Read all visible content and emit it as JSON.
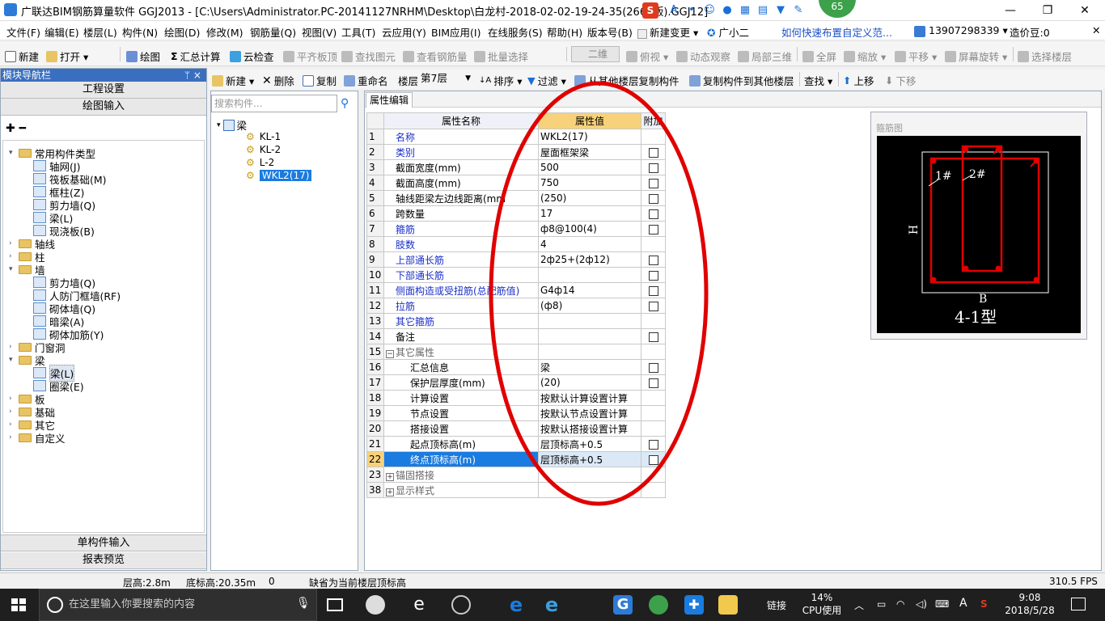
{
  "window": {
    "title": "广联达BIM钢筋算量软件 GGJ2013 - [C:\\Users\\Administrator.PC-20141127NRHM\\Desktop\\白龙村-2018-02-02-19-24-35(2666版).GGJ12]",
    "badge": "65",
    "controls": {
      "minimize": "—",
      "maximize": "❐",
      "close": "✕"
    }
  },
  "menubar": {
    "items": [
      "文件(F)",
      "编辑(E)",
      "楼层(L)",
      "构件(N)",
      "绘图(D)",
      "修改(M)",
      "钢筋量(Q)",
      "视图(V)",
      "工具(T)",
      "云应用(Y)",
      "BIM应用(I)",
      "在线服务(S)",
      "帮助(H)",
      "版本号(B)",
      "新建变更 ▾",
      "广小二"
    ],
    "help_link": "如何快速布置自定义范...",
    "phone": "13907298339 ▾",
    "coins": "造价豆:0"
  },
  "toolbar1": {
    "new": "新建",
    "open": "打开 ▾",
    "draw": "绘图",
    "sum": "汇总计算",
    "cloud_check": "云检查",
    "flat_roof": "平齐板顶",
    "find_elem": "查找图元",
    "view_qty": "查看钢筋量",
    "batch_select": "批量选择",
    "view_mode": "二维",
    "top_view": "俯视 ▾",
    "dynamic": "动态观察",
    "local3d": "局部三维",
    "fullscreen": "全屏",
    "zoom": "缩放 ▾",
    "pan": "平移 ▾",
    "rotate": "屏幕旋转 ▾",
    "floor_select": "选择楼层"
  },
  "toolbar2": {
    "new": "新建 ▾",
    "delete": "删除",
    "copy": "复制",
    "rename": "重命名",
    "floor_label": "楼层",
    "floor_value": "第7层",
    "sort": "排序 ▾",
    "filter": "过滤 ▾",
    "copy_from": "从其他楼层复制构件",
    "copy_to": "复制构件到其他楼层",
    "find": "查找 ▾",
    "move_up": "上移",
    "move_down": "下移"
  },
  "nav": {
    "header": "模块导航栏",
    "pin": "ᛘ ×",
    "project_settings": "工程设置",
    "draw_input": "绘图输入",
    "single_input": "单构件输入",
    "report": "报表预览",
    "tree": [
      {
        "label": "常用构件类型",
        "level": 0,
        "toggle": "▾",
        "type": "folder"
      },
      {
        "label": "轴网(J)",
        "level": 1,
        "type": "item"
      },
      {
        "label": "筏板基础(M)",
        "level": 1,
        "type": "item"
      },
      {
        "label": "框柱(Z)",
        "level": 1,
        "type": "item"
      },
      {
        "label": "剪力墙(Q)",
        "level": 1,
        "type": "item"
      },
      {
        "label": "梁(L)",
        "level": 1,
        "type": "item"
      },
      {
        "label": "现浇板(B)",
        "level": 1,
        "type": "item"
      },
      {
        "label": "轴线",
        "level": 0,
        "toggle": "›",
        "type": "folder"
      },
      {
        "label": "柱",
        "level": 0,
        "toggle": "›",
        "type": "folder"
      },
      {
        "label": "墙",
        "level": 0,
        "toggle": "▾",
        "type": "folder"
      },
      {
        "label": "剪力墙(Q)",
        "level": 1,
        "type": "item"
      },
      {
        "label": "人防门框墙(RF)",
        "level": 1,
        "type": "item"
      },
      {
        "label": "砌体墙(Q)",
        "level": 1,
        "type": "item"
      },
      {
        "label": "暗梁(A)",
        "level": 1,
        "type": "item"
      },
      {
        "label": "砌体加筋(Y)",
        "level": 1,
        "type": "item"
      },
      {
        "label": "门窗洞",
        "level": 0,
        "toggle": "›",
        "type": "folder"
      },
      {
        "label": "梁",
        "level": 0,
        "toggle": "▾",
        "type": "folder"
      },
      {
        "label": "梁(L)",
        "level": 1,
        "type": "item",
        "selected": true
      },
      {
        "label": "圈梁(E)",
        "level": 1,
        "type": "item"
      },
      {
        "label": "板",
        "level": 0,
        "toggle": "›",
        "type": "folder"
      },
      {
        "label": "基础",
        "level": 0,
        "toggle": "›",
        "type": "folder"
      },
      {
        "label": "其它",
        "level": 0,
        "toggle": "›",
        "type": "folder"
      },
      {
        "label": "自定义",
        "level": 0,
        "toggle": "›",
        "type": "folder"
      }
    ]
  },
  "components": {
    "search_placeholder": "搜索构件...",
    "root": "梁",
    "items": [
      "KL-1",
      "KL-2",
      "L-2",
      "WKL2(17)"
    ],
    "selected": "WKL2(17)"
  },
  "property_panel": {
    "tab": "属性编辑",
    "headers": {
      "name": "属性名称",
      "value": "属性值",
      "extra": "附加"
    },
    "rows": [
      {
        "no": "1",
        "name": "名称",
        "value": "WKL2(17)",
        "cb": false,
        "style": "blue"
      },
      {
        "no": "2",
        "name": "类别",
        "value": "屋面框架梁",
        "cb": true,
        "style": "blue"
      },
      {
        "no": "3",
        "name": "截面宽度(mm)",
        "value": "500",
        "cb": true,
        "style": ""
      },
      {
        "no": "4",
        "name": "截面高度(mm)",
        "value": "750",
        "cb": true,
        "style": ""
      },
      {
        "no": "5",
        "name": "轴线距梁左边线距离(mm",
        "value": "(250)",
        "cb": true,
        "style": ""
      },
      {
        "no": "6",
        "name": "跨数量",
        "value": "17",
        "cb": true,
        "style": ""
      },
      {
        "no": "7",
        "name": "箍筋",
        "value": "ф8@100(4)",
        "cb": true,
        "style": "blue"
      },
      {
        "no": "8",
        "name": "肢数",
        "value": "4",
        "cb": false,
        "style": "blue"
      },
      {
        "no": "9",
        "name": "上部通长筋",
        "value": "2ф25+(2ф12)",
        "cb": true,
        "style": "blue"
      },
      {
        "no": "10",
        "name": "下部通长筋",
        "value": "",
        "cb": true,
        "style": "blue"
      },
      {
        "no": "11",
        "name": "侧面构造或受扭筋(总配筋值)",
        "value": "G4ф14",
        "cb": true,
        "style": "blue"
      },
      {
        "no": "12",
        "name": "拉筋",
        "value": "(ф8)",
        "cb": true,
        "style": "blue"
      },
      {
        "no": "13",
        "name": "其它箍筋",
        "value": "",
        "cb": false,
        "style": "blue"
      },
      {
        "no": "14",
        "name": "备注",
        "value": "",
        "cb": true,
        "style": ""
      },
      {
        "no": "15",
        "name": "其它属性",
        "value": "",
        "cb": false,
        "style": "gray",
        "group": "−"
      },
      {
        "no": "16",
        "name": "汇总信息",
        "value": "梁",
        "cb": true,
        "style": "",
        "indent": true
      },
      {
        "no": "17",
        "name": "保护层厚度(mm)",
        "value": "(20)",
        "cb": true,
        "style": "",
        "indent": true
      },
      {
        "no": "18",
        "name": "计算设置",
        "value": "按默认计算设置计算",
        "cb": false,
        "style": "",
        "indent": true
      },
      {
        "no": "19",
        "name": "节点设置",
        "value": "按默认节点设置计算",
        "cb": false,
        "style": "",
        "indent": true
      },
      {
        "no": "20",
        "name": "搭接设置",
        "value": "按默认搭接设置计算",
        "cb": false,
        "style": "",
        "indent": true
      },
      {
        "no": "21",
        "name": "起点顶标高(m)",
        "value": "层顶标高+0.5",
        "cb": true,
        "style": "",
        "indent": true
      },
      {
        "no": "22",
        "name": "终点顶标高(m)",
        "value": "层顶标高+0.5",
        "cb": true,
        "style": "",
        "indent": true,
        "selected": true
      },
      {
        "no": "23",
        "name": "锚固搭接",
        "value": "",
        "cb": false,
        "style": "gray",
        "group": "+"
      },
      {
        "no": "38",
        "name": "显示样式",
        "value": "",
        "cb": false,
        "style": "gray",
        "group": "+"
      }
    ]
  },
  "stirrup": {
    "title": "箍筋图",
    "label_1": "1#",
    "label_2": "2#",
    "label_h": "H",
    "label_b": "B",
    "type_label": "4-1型"
  },
  "statusbar": {
    "floor_height": "层高:2.8m",
    "base_elev": "底标高:20.35m",
    "zero": "0",
    "message": "缺省为当前楼层顶标高",
    "fps": "310.5 FPS"
  },
  "taskbar": {
    "search_placeholder": "在这里输入你要搜索的内容",
    "link": "链接",
    "cpu_percent": "14%",
    "cpu_label": "CPU使用",
    "ime": "A",
    "time": "9:08",
    "date": "2018/5/28"
  },
  "colors": {
    "highlight": "#1a7be0",
    "accent_red": "#e00000",
    "link_blue": "#1a2fc8"
  }
}
